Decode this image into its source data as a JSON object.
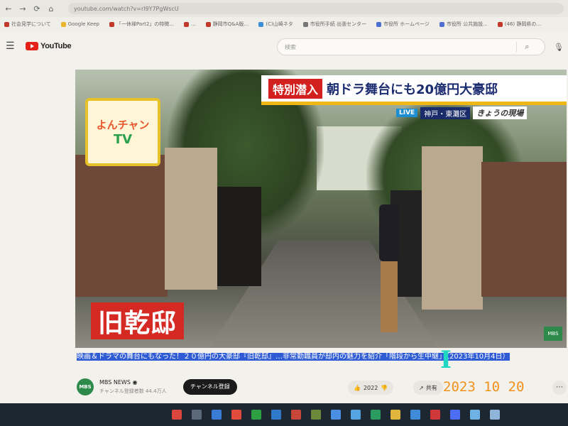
{
  "browser": {
    "back": "←",
    "forward": "→",
    "reload": "⟳",
    "home": "⌂",
    "url": "youtube.com/watch?v=rl9Y7PgWscU"
  },
  "bookmarks": [
    {
      "label": "社会見学について"
    },
    {
      "label": "Google Keep"
    },
    {
      "label": "「一休禅Part2」の特徴..."
    },
    {
      "label": "..."
    },
    {
      "label": "静岡市Q&A版…"
    },
    {
      "label": "(C)山崎ネタ"
    },
    {
      "label": "市役所手続 出張センター"
    },
    {
      "label": "市役所 ホームページ"
    },
    {
      "label": "市役所 公共施設..."
    },
    {
      "label": "(46) 静岡県の…"
    }
  ],
  "header": {
    "logo_text": "YouTube",
    "search_placeholder": "検索",
    "search_icon": "search-icon",
    "menu_icon": "menu-icon"
  },
  "video": {
    "banner_tag": "特別潜入",
    "banner_text": "朝ドラ舞台にも20億円大豪邸",
    "live_tag": "LIVE",
    "location": "神戸・東灘区",
    "segment": "きょうの現場",
    "logo_top": "よんチャン",
    "logo_tv": "TV",
    "caption": "旧乾邸",
    "corner_badge": "MBS"
  },
  "title": {
    "text": "映画＆ドラマの舞台にもなった！２０億円の大豪邸『旧乾邸』…非常勤職員が邸内の魅力を紹介「階段から生中継」（2023年10月4日）"
  },
  "channel": {
    "avatar_text": "MBS",
    "name": "MBS NEWS ◉",
    "subs": "チャンネル登録者数 44.4万人",
    "subscribe_label": "チャンネル登録",
    "like_count": "2022",
    "like_icon": "thumbs-up-icon",
    "dislike_icon": "thumbs-down-icon",
    "share_label": "共有",
    "more_icon": "more-horizontal-icon"
  },
  "photo_date_stamp": "2023 10 20",
  "taskbar_icon_colors": [
    "#d9463e",
    "#5b6b7c",
    "#3a7bd5",
    "#e04b3b",
    "#2ea043",
    "#3079c8",
    "#c7463a",
    "#6a8a3a",
    "#4b8fe2",
    "#56a3e2",
    "#2b9b5f",
    "#e0b63e",
    "#3f8bd9",
    "#d03737",
    "#4c6ef5",
    "#6fb3e4",
    "#8fb4d9"
  ]
}
